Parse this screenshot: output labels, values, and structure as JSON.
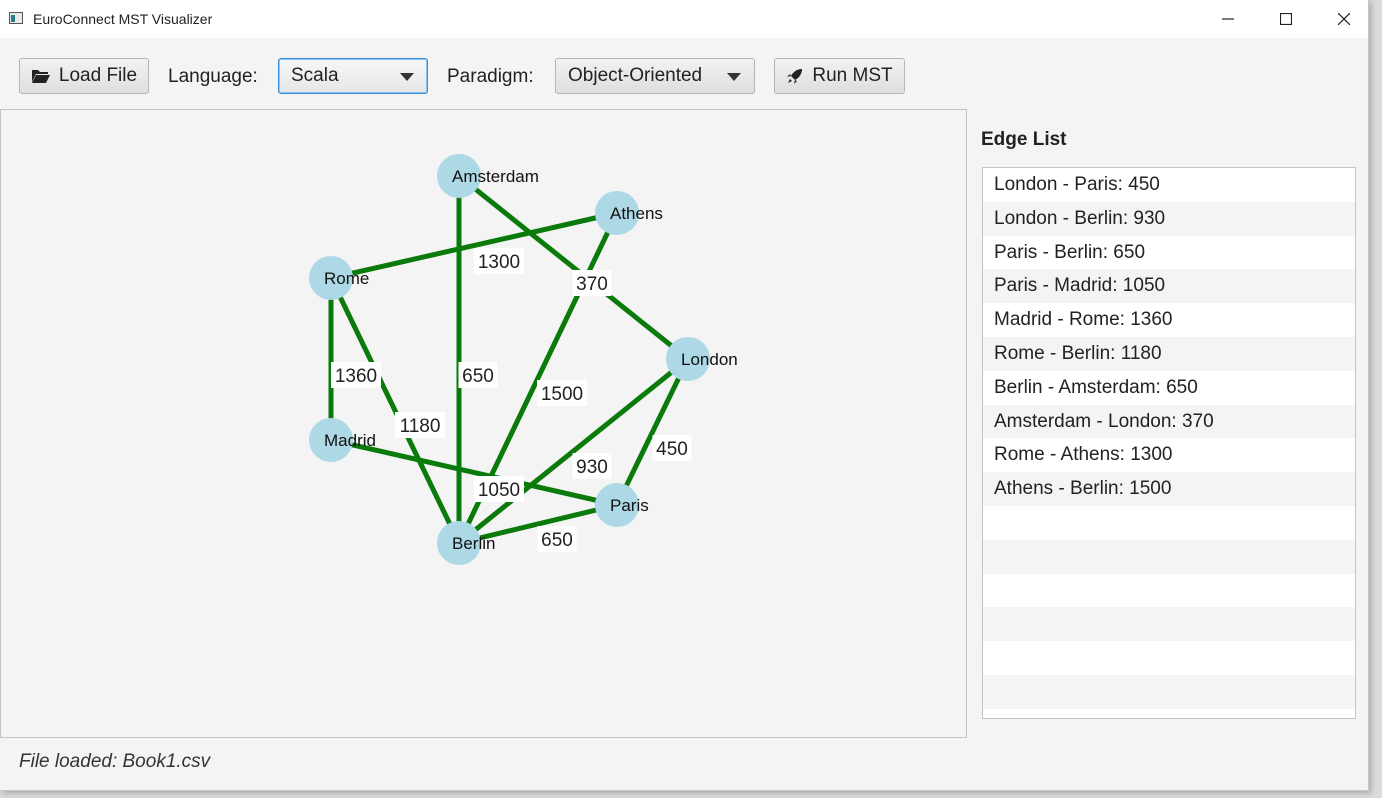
{
  "window": {
    "title": "EuroConnect MST Visualizer",
    "controls": {
      "minimize": "—",
      "maximize": "☐",
      "close": "✕"
    }
  },
  "toolbar": {
    "load_label": "Load File",
    "load_icon": "folder-open-icon",
    "language_label": "Language:",
    "language_value": "Scala",
    "paradigm_label": "Paradigm:",
    "paradigm_value": "Object-Oriented",
    "run_label": "Run MST",
    "run_icon": "rocket-icon"
  },
  "graph": {
    "edge_color": "#0a7a0a",
    "node_color": "#add8e6",
    "nodes": [
      {
        "id": "amsterdam",
        "label": "Amsterdam"
      },
      {
        "id": "athens",
        "label": "Athens"
      },
      {
        "id": "rome",
        "label": "Rome"
      },
      {
        "id": "london",
        "label": "London"
      },
      {
        "id": "madrid",
        "label": "Madrid"
      },
      {
        "id": "paris",
        "label": "Paris"
      },
      {
        "id": "berlin",
        "label": "Berlin"
      }
    ],
    "edges": [
      {
        "from": "london",
        "to": "paris",
        "weight": "450"
      },
      {
        "from": "london",
        "to": "berlin",
        "weight": "930"
      },
      {
        "from": "paris",
        "to": "berlin",
        "weight": "650"
      },
      {
        "from": "paris",
        "to": "madrid",
        "weight": "1050"
      },
      {
        "from": "madrid",
        "to": "rome",
        "weight": "1360"
      },
      {
        "from": "rome",
        "to": "berlin",
        "weight": "1180"
      },
      {
        "from": "berlin",
        "to": "amsterdam",
        "weight": "650"
      },
      {
        "from": "amsterdam",
        "to": "london",
        "weight": "370"
      },
      {
        "from": "rome",
        "to": "athens",
        "weight": "1300"
      },
      {
        "from": "athens",
        "to": "berlin",
        "weight": "1500"
      }
    ]
  },
  "sidebar": {
    "title": "Edge List",
    "items": [
      "London - Paris: 450",
      "London - Berlin: 930",
      "Paris - Berlin: 650",
      "Paris - Madrid: 1050",
      "Madrid - Rome: 1360",
      "Rome - Berlin: 1180",
      "Berlin - Amsterdam: 650",
      "Amsterdam - London: 370",
      "Rome - Athens: 1300",
      "Athens - Berlin: 1500"
    ],
    "empty_rows": 6
  },
  "status": {
    "text": "File loaded: Book1.csv"
  }
}
